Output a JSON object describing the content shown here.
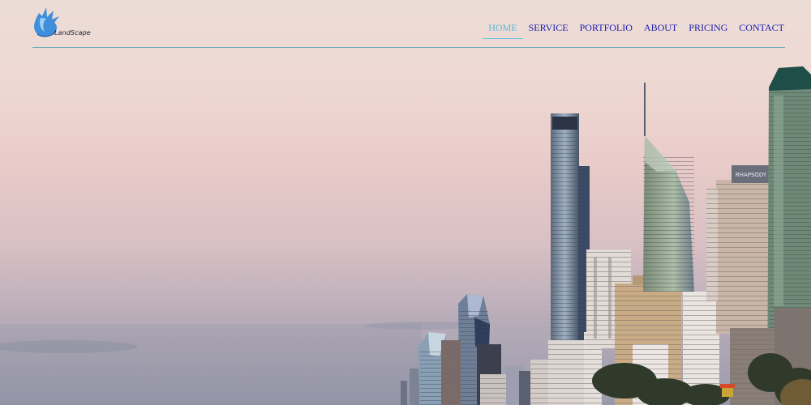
{
  "brand": {
    "logo_text": "LandScape",
    "logo_icon": "flame-leaf-icon",
    "logo_color": "#3f8fdc"
  },
  "nav": {
    "items": [
      {
        "label": "HOME",
        "active": true
      },
      {
        "label": "SERVICE",
        "active": false
      },
      {
        "label": "PORTFOLIO",
        "active": false
      },
      {
        "label": "ABOUT",
        "active": false
      },
      {
        "label": "PRICING",
        "active": false
      },
      {
        "label": "CONTACT",
        "active": false
      }
    ],
    "active_color": "#5ab8d6",
    "link_color": "#1c1cae",
    "divider_color": "#5fa6b5"
  },
  "hero": {
    "scene": "city skyline at dusk",
    "building_sign": "RHAPSODY"
  }
}
